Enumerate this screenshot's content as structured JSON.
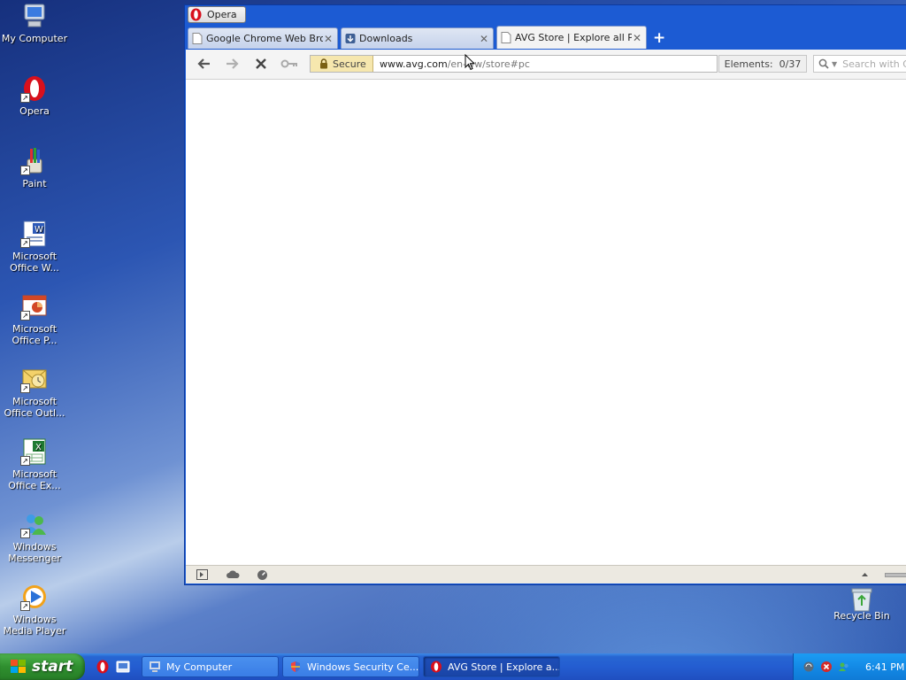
{
  "desktop": {
    "icons": [
      {
        "label": "My Computer",
        "icon": "my-computer-icon"
      },
      {
        "label": "Opera",
        "icon": "opera-icon"
      },
      {
        "label": "Paint",
        "icon": "paint-icon"
      },
      {
        "label": "Microsoft Office W...",
        "icon": "word-icon"
      },
      {
        "label": "Microsoft Office P...",
        "icon": "powerpoint-icon"
      },
      {
        "label": "Microsoft Office Outl...",
        "icon": "outlook-icon"
      },
      {
        "label": "Microsoft Office Ex...",
        "icon": "excel-icon"
      },
      {
        "label": "Windows Messenger",
        "icon": "messenger-icon"
      },
      {
        "label": "Windows Media Player",
        "icon": "media-player-icon"
      }
    ],
    "recycle_bin": {
      "label": "Recycle Bin",
      "icon": "recycle-bin-icon"
    }
  },
  "browser": {
    "menu_label": "Opera",
    "tabs": [
      {
        "title": "Google Chrome Web Bro...",
        "icon": "page-icon",
        "active": false
      },
      {
        "title": "Downloads",
        "icon": "download-icon",
        "active": false
      },
      {
        "title": "AVG Store | Explore all P...",
        "icon": "page-icon",
        "active": true
      }
    ],
    "new_tab_label": "+",
    "address": {
      "secure_label": "Secure",
      "url_host": "www.avg.com",
      "url_path": "/en-ww/store#pc"
    },
    "elements_label": "Elements:",
    "elements_value": "0/37",
    "search_placeholder": "Search with Google"
  },
  "taskbar": {
    "start_label": "start",
    "buttons": [
      {
        "label": "My Computer",
        "icon": "my-computer-icon",
        "active": false
      },
      {
        "label": "Windows Security Ce...",
        "icon": "shield-icon",
        "active": false
      },
      {
        "label": "AVG Store | Explore a...",
        "icon": "opera-icon",
        "active": true
      }
    ],
    "clock": "6:41 PM"
  },
  "colors": {
    "taskbar_blue": "#245dd1",
    "start_green": "#2f8f2f",
    "window_frame": "#1c5bd3",
    "secure_badge": "#f6e7ae"
  }
}
